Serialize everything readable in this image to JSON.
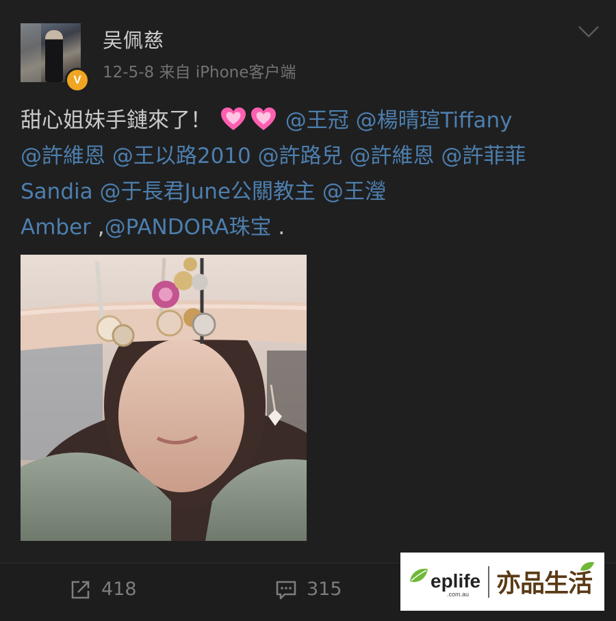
{
  "post": {
    "username": "吴佩慈",
    "verified_badge": "V",
    "meta": "12-5-8  来自 iPhone客户端",
    "icons": {
      "menu": "chevron-down-icon",
      "verified": "verified-badge-icon",
      "emoji": "growing-heart-emoji"
    },
    "content": {
      "line1_text": "甜心姐妹手鏈來了！",
      "line1_mentions": [
        "@王冠",
        "@楊晴瑄Tiffany"
      ],
      "line2_mentions": [
        "@許維恩",
        "@王以路2010",
        "@許路兒",
        "@許維恩",
        "@許菲菲"
      ],
      "line3_mentions": [
        "Sandia",
        "@于長君June公關教主",
        "@王瀅"
      ],
      "line4_mention_a": "Amber",
      "line4_sep": " ,",
      "line4_mention_b": "@PANDORA珠宝",
      "line4_end": " ."
    }
  },
  "actions": {
    "repost_count": "418",
    "comment_count": "315",
    "repost_icon": "share-icon",
    "comment_icon": "comment-icon"
  },
  "watermark": {
    "brand_latin": "eplife",
    "domain": ".com.au",
    "brand_cn": "亦品生活"
  },
  "colors": {
    "background": "#1f1f20",
    "mention": "#4d7fae",
    "text": "#c9c9c9",
    "muted": "#727272",
    "badge": "#f0a623",
    "heart": "#ff5fb0"
  }
}
